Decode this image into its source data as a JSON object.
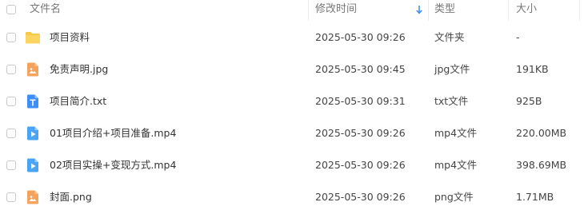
{
  "header": {
    "name_label": "文件名",
    "modified_label": "修改时间",
    "type_label": "类型",
    "size_label": "大小",
    "sort_column": "modified",
    "sort_direction": "descending"
  },
  "colors": {
    "folder": "#f7c948",
    "image": "#f5a25d",
    "text": "#3d8ef8",
    "video": "#4aa3f3",
    "accent": "#3d8ef8"
  },
  "files": [
    {
      "name": "项目资料",
      "modified": "2025-05-30 09:26",
      "type": "文件夹",
      "size": "-",
      "icon": "folder-icon"
    },
    {
      "name": "免责声明.jpg",
      "modified": "2025-05-30 09:45",
      "type": "jpg文件",
      "size": "191KB",
      "icon": "image-file-icon"
    },
    {
      "name": "项目简介.txt",
      "modified": "2025-05-30 09:31",
      "type": "txt文件",
      "size": "925B",
      "icon": "text-file-icon"
    },
    {
      "name": "01项目介绍+项目准备.mp4",
      "modified": "2025-05-30 09:26",
      "type": "mp4文件",
      "size": "220.00MB",
      "icon": "video-file-icon"
    },
    {
      "name": "02项目实操+变现方式.mp4",
      "modified": "2025-05-30 09:26",
      "type": "mp4文件",
      "size": "398.69MB",
      "icon": "video-file-icon"
    },
    {
      "name": "封面.png",
      "modified": "2025-05-30 09:26",
      "type": "png文件",
      "size": "1.71MB",
      "icon": "image-file-icon"
    }
  ]
}
